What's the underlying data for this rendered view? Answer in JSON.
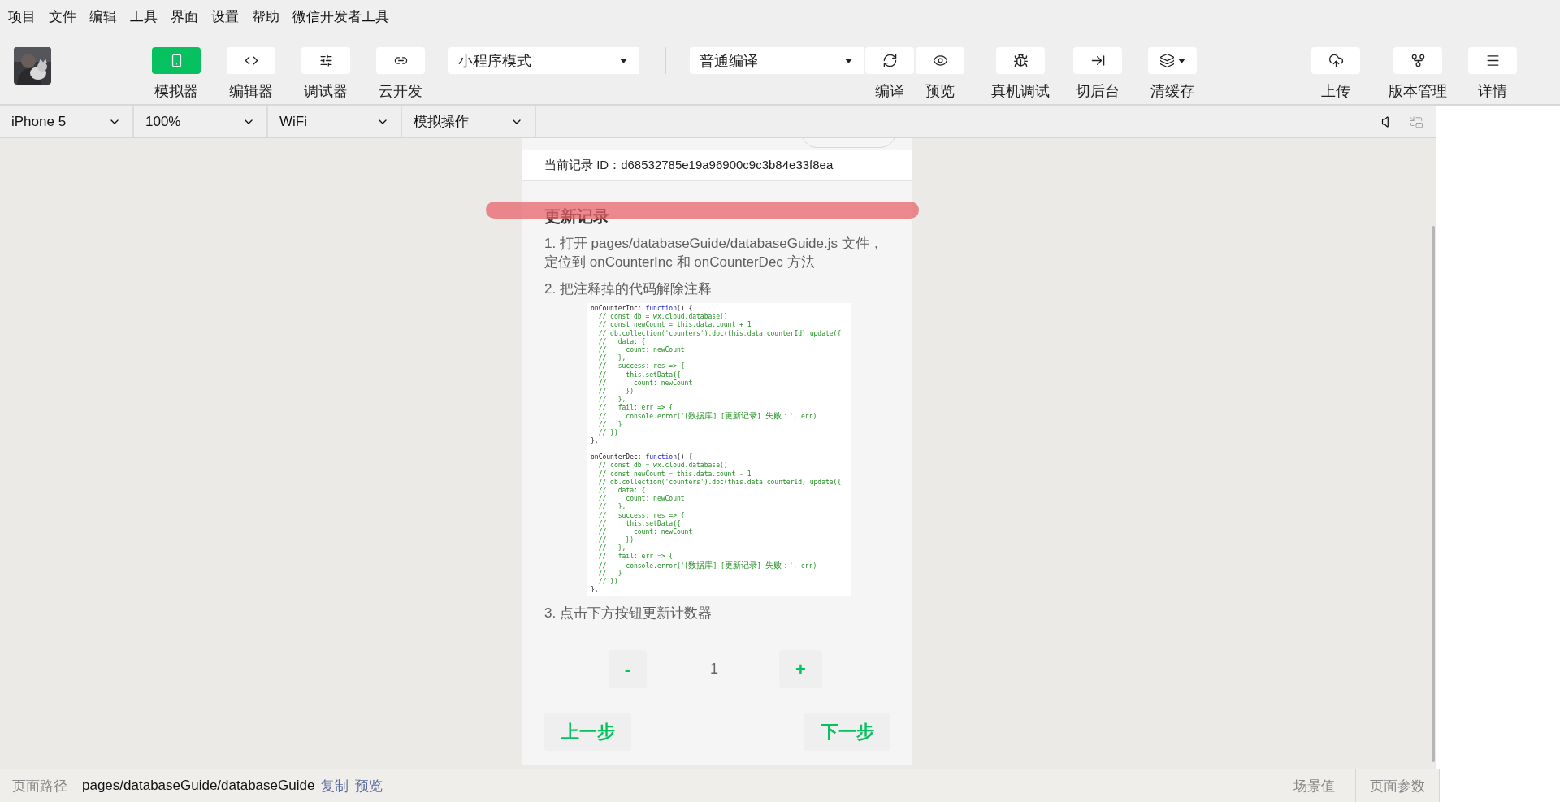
{
  "menu": [
    "项目",
    "文件",
    "编辑",
    "工具",
    "界面",
    "设置",
    "帮助",
    "微信开发者工具"
  ],
  "toolbar": {
    "view_toggles": [
      {
        "label": "模拟器",
        "on": true
      },
      {
        "label": "编辑器",
        "on": false
      },
      {
        "label": "调试器",
        "on": false
      },
      {
        "label": "云开发",
        "on": false
      }
    ],
    "mode_select": "小程序模式",
    "compile_select": "普通编译",
    "compile_actions": [
      "编译",
      "预览"
    ],
    "tools": [
      {
        "label": "真机调试",
        "has_menu": false
      },
      {
        "label": "切后台",
        "has_menu": false
      },
      {
        "label": "清缓存",
        "has_menu": true
      }
    ],
    "right_tools": [
      "上传",
      "版本管理",
      "详情"
    ]
  },
  "device_bar": {
    "selects": [
      "iPhone 5",
      "100%",
      "WiFi",
      "模拟操作"
    ]
  },
  "phone": {
    "record_id": "当前记录 ID：d68532785e19a96900c9c3b84e33f8ea",
    "heading": {
      "text": "更新记录",
      "highlighted": true
    },
    "content": [
      {
        "kind": "step",
        "text": "1. 打开 pages/databaseGuide/databaseGuide.js 文件，定位到 onCounterInc 和 onCounterDec 方法"
      },
      {
        "kind": "step",
        "text": "2. 把注释掉的代码解除注释"
      },
      {
        "kind": "code",
        "blocks": [
          {
            "lines": [
              {
                "kind": "decl",
                "name": "onCounterInc: ",
                "keyword": "function",
                "rest": "() {"
              },
              {
                "kind": "comment",
                "text": "  // const db = wx.cloud.database()"
              },
              {
                "kind": "comment",
                "text": "  // const newCount = this.data.count + 1"
              },
              {
                "kind": "comment",
                "text": "  // db.collection('counters').doc(this.data.counterId).update({"
              },
              {
                "kind": "comment",
                "text": "  //   data: {"
              },
              {
                "kind": "comment",
                "text": "  //     count: newCount"
              },
              {
                "kind": "comment",
                "text": "  //   },"
              },
              {
                "kind": "comment",
                "text": "  //   success: res => {"
              },
              {
                "kind": "comment",
                "text": "  //     this.setData({"
              },
              {
                "kind": "comment",
                "text": "  //       count: newCount"
              },
              {
                "kind": "comment",
                "text": "  //     })"
              },
              {
                "kind": "comment",
                "text": "  //   },"
              },
              {
                "kind": "comment",
                "text": "  //   fail: err => {"
              },
              {
                "kind": "comment",
                "text": "  //     console.error('[数据库] [更新记录] 失败：', err)"
              },
              {
                "kind": "comment",
                "text": "  //   }"
              },
              {
                "kind": "comment",
                "text": "  // })"
              },
              {
                "kind": "plain",
                "text": "},"
              }
            ]
          },
          {
            "lines": [
              {
                "kind": "decl",
                "name": "onCounterDec: ",
                "keyword": "function",
                "rest": "() {"
              },
              {
                "kind": "comment",
                "text": "  // const db = wx.cloud.database()"
              },
              {
                "kind": "comment",
                "text": "  // const newCount = this.data.count - 1"
              },
              {
                "kind": "comment",
                "text": "  // db.collection('counters').doc(this.data.counterId).update({"
              },
              {
                "kind": "comment",
                "text": "  //   data: {"
              },
              {
                "kind": "comment",
                "text": "  //     count: newCount"
              },
              {
                "kind": "comment",
                "text": "  //   },"
              },
              {
                "kind": "comment",
                "text": "  //   success: res => {"
              },
              {
                "kind": "comment",
                "text": "  //     this.setData({"
              },
              {
                "kind": "comment",
                "text": "  //       count: newCount"
              },
              {
                "kind": "comment",
                "text": "  //     })"
              },
              {
                "kind": "comment",
                "text": "  //   },"
              },
              {
                "kind": "comment",
                "text": "  //   fail: err => {"
              },
              {
                "kind": "comment",
                "text": "  //     console.error('[数据库] [更新记录] 失败：', err)"
              },
              {
                "kind": "comment",
                "text": "  //   }"
              },
              {
                "kind": "comment",
                "text": "  // })"
              },
              {
                "kind": "plain",
                "text": "},"
              }
            ]
          }
        ]
      },
      {
        "kind": "step",
        "text": "3. 点击下方按钮更新计数器"
      }
    ],
    "counter": {
      "minus": "-",
      "value": "1",
      "plus": "+"
    },
    "nav": {
      "prev": "上一步",
      "next": "下一步"
    }
  },
  "status_bar": {
    "label": "页面路径",
    "path": "pages/databaseGuide/databaseGuide",
    "links": [
      "复制",
      "预览"
    ],
    "right": [
      "场景值",
      "页面参数"
    ]
  }
}
